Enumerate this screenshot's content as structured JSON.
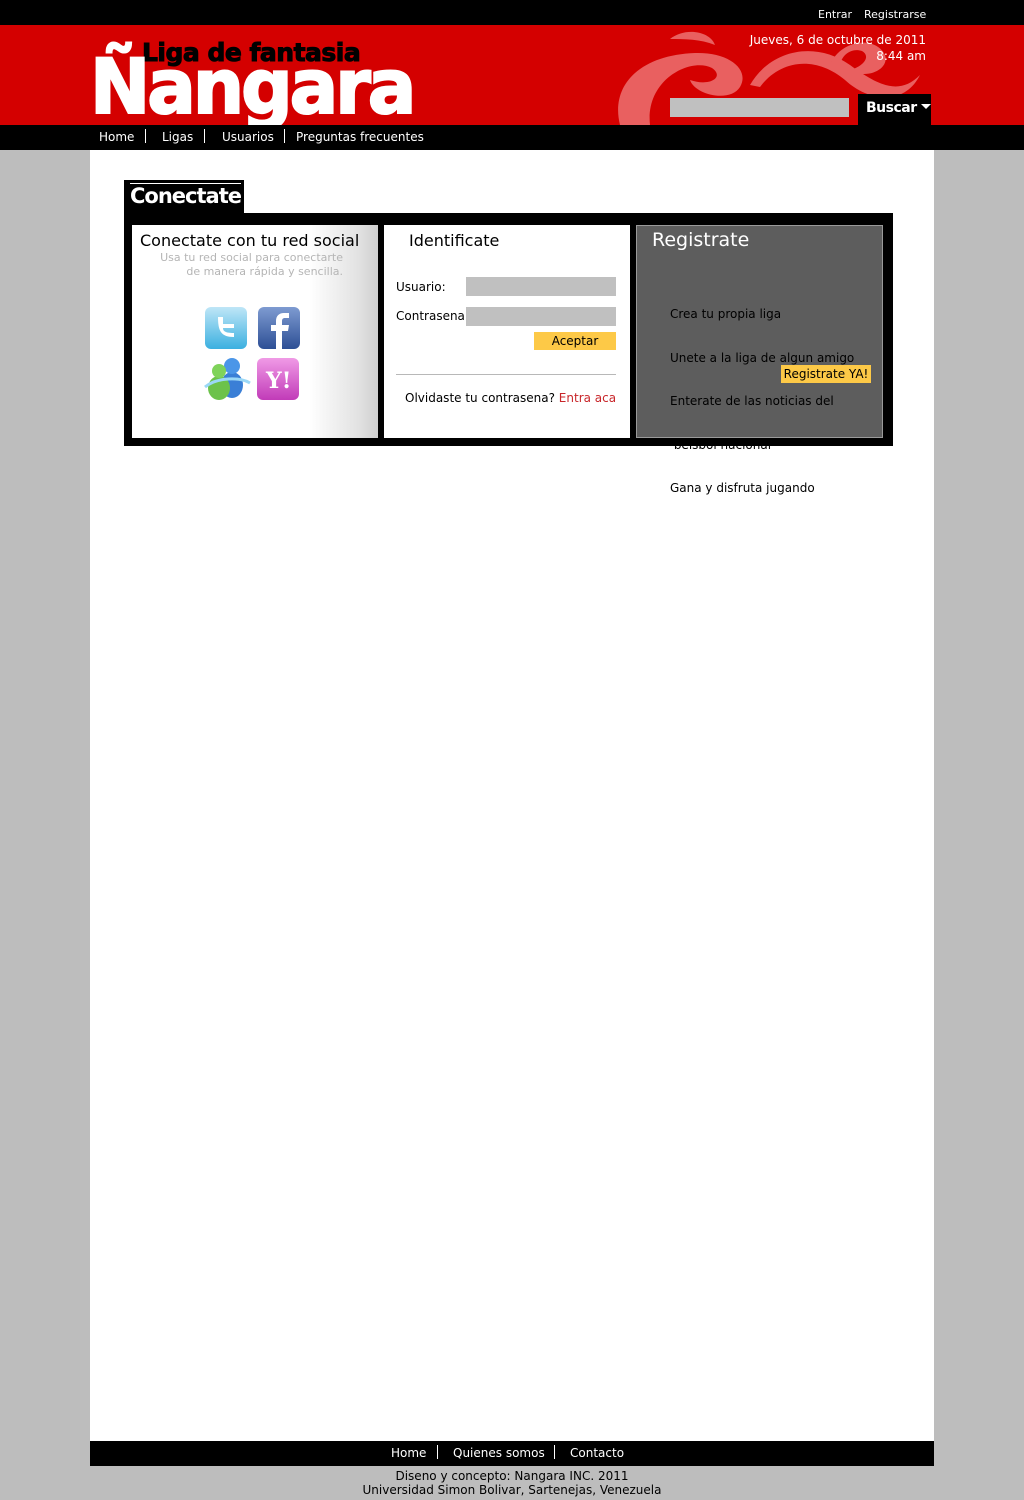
{
  "top_links": {
    "login": "Entrar",
    "register": "Registrarse"
  },
  "header": {
    "logo_subtitle": "Liga de fantasia",
    "logo_name": "Ñangara",
    "date": "Jueves, 6 de octubre de 2011",
    "time": "8:44 am",
    "search_value": "",
    "search_button": "Buscar",
    "brand_color": "#d40000"
  },
  "nav": {
    "items": [
      "Home",
      "Ligas",
      "Usuarios",
      "Preguntas frecuentes"
    ]
  },
  "connect": {
    "tab_title": "Conectate",
    "social": {
      "title": "Conectate con tu red social",
      "subtitle_line1": "Usa tu red social para conectarte",
      "subtitle_line2": "de manera rápida y sencilla.",
      "icons": [
        "twitter-icon",
        "facebook-icon",
        "messenger-icon",
        "yahoo-icon"
      ]
    },
    "login": {
      "title": "Identificate",
      "user_label": "Usuario:",
      "user_value": "",
      "password_label": "Contrasena:",
      "password_value": "",
      "accept_button": "Aceptar",
      "forgot_text": "Olvidaste tu contrasena?",
      "forgot_link": "Entra aca"
    },
    "register": {
      "title": "Registrate",
      "benefits": [
        "Crea tu propia liga",
        "Unete a la liga de algun amigo",
        "Enterate de las noticias del",
        " beisbol nacional",
        "Gana y disfruta jugando"
      ],
      "button": "Registrate YA!",
      "button_color": "#fdc947"
    }
  },
  "footer": {
    "links": [
      "Home",
      "Quienes somos",
      "Contacto"
    ],
    "credits_line1": "Diseno y concepto: Nangara INC. 2011",
    "credits_line2": "Universidad Simon Bolivar, Sartenejas, Venezuela"
  }
}
